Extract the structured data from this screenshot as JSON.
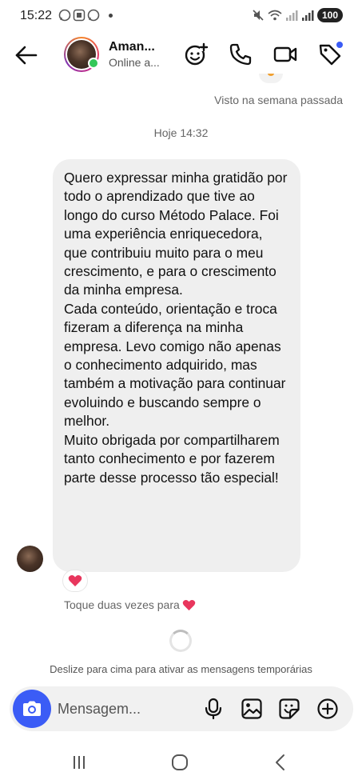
{
  "status_bar": {
    "time": "15:22",
    "battery": "100"
  },
  "header": {
    "contact_name": "Aman...",
    "contact_status": "Online a...",
    "icons": [
      "back-arrow-icon",
      "add-emoji-icon",
      "phone-icon",
      "video-camera-icon",
      "tag-icon"
    ]
  },
  "thread": {
    "seen_label": "Visto na semana passada",
    "date_separator": "Hoje 14:32",
    "message": {
      "text": "Quero expressar minha gratidão por todo o aprendizado que tive ao longo do curso Método Palace. Foi uma experiência enriquecedora, que contribuiu muito para o meu crescimento, e para o crescimento da minha empresa.\nCada conteúdo, orientação e troca fizeram a diferença na minha empresa. Levo comigo não apenas o conhecimento adquirido, mas também a motivação para continuar evoluindo e buscando sempre o melhor.\nMuito obrigada por compartilharem tanto conhecimento e por fazerem parte desse processo tão especial!",
      "reaction": "heart"
    },
    "double_tap_hint": "Toque duas vezes para",
    "vanish_mode_hint": "Deslize para cima para ativar as mensagens temporárias"
  },
  "composer": {
    "placeholder": "Mensagem...",
    "icons": [
      "camera-icon",
      "microphone-icon",
      "gallery-icon",
      "sticker-icon",
      "plus-circle-icon"
    ]
  },
  "colors": {
    "accent": "#3b5cf6",
    "bubble": "#efefef",
    "heart": "#e8365d",
    "online": "#34c759"
  }
}
